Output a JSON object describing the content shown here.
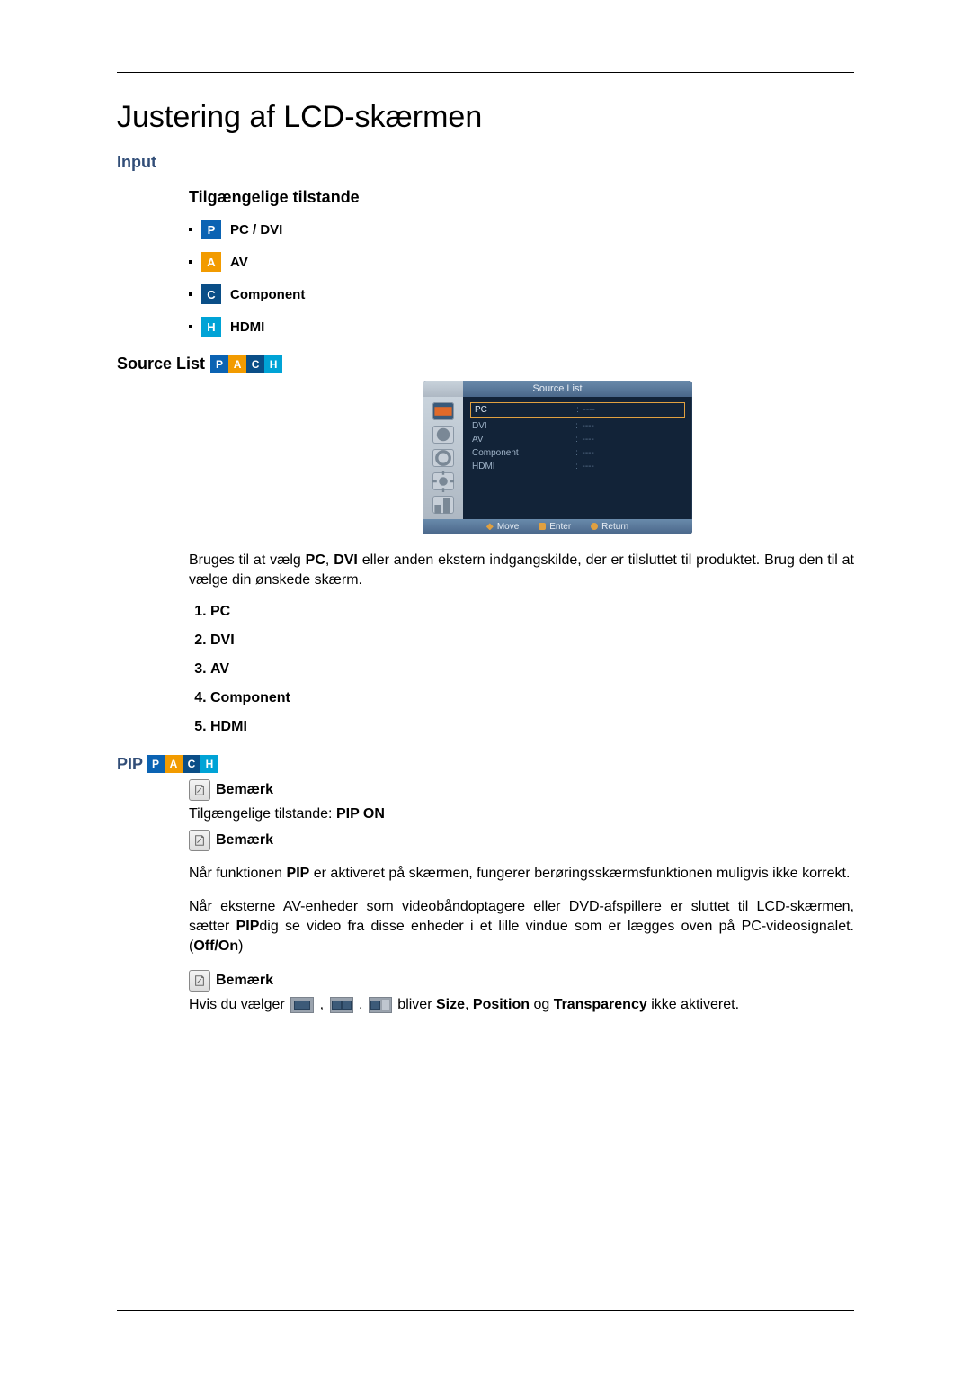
{
  "title": "Justering af LCD-skærmen",
  "sections": {
    "input_heading": "Input",
    "modes_heading": "Tilgængelige tilstande",
    "modes": [
      {
        "badge": "P",
        "label": "PC / DVI"
      },
      {
        "badge": "A",
        "label": "AV"
      },
      {
        "badge": "C",
        "label": "Component"
      },
      {
        "badge": "H",
        "label": "HDMI"
      }
    ],
    "source_list_heading": "Source List",
    "source_badges": [
      "P",
      "A",
      "C",
      "H"
    ],
    "osd": {
      "title": "Source List",
      "rows": [
        {
          "k": "PC",
          "v": "----",
          "selected": true
        },
        {
          "k": "DVI",
          "v": "----"
        },
        {
          "k": "AV",
          "v": "----"
        },
        {
          "k": "Component",
          "v": "----"
        },
        {
          "k": "HDMI",
          "v": "----"
        }
      ],
      "footer": {
        "move": "Move",
        "enter": "Enter",
        "return": "Return"
      }
    },
    "source_para_1a": "Bruges til at vælg ",
    "source_para_1b": "PC",
    "source_para_1c": ", ",
    "source_para_1d": "DVI",
    "source_para_1e": " eller anden ekstern indgangskilde, der er tilsluttet til produktet. Brug den til at vælge din ønskede skærm.",
    "source_items": [
      "PC",
      "DVI",
      "AV",
      "Component",
      "HDMI"
    ],
    "pip_heading": "PIP",
    "pip_badges": [
      "P",
      "A",
      "C",
      "H"
    ],
    "note_label": "Bemærk",
    "pip_modes_a": "Tilgængelige tilstande: ",
    "pip_modes_b": "PIP ON",
    "pip_para2_a": "Når funktionen ",
    "pip_para2_b": "PIP",
    "pip_para2_c": " er aktiveret på skærmen, fungerer berøringsskærmsfunktionen muligvis ikke korrekt.",
    "pip_para3_a": "Når eksterne AV-enheder som videobåndoptagere eller DVD-afspillere er sluttet til LCD-skærmen, sætter ",
    "pip_para3_b": "PIP",
    "pip_para3_c": "dig se video fra disse enheder i et lille vindue som er lægges oven på PC-videosignalet. (",
    "pip_para3_d": "Off/On",
    "pip_para3_e": ")",
    "pip_para4_a": "Hvis du vælger ",
    "pip_para4_b": " , ",
    "pip_para4_c": " , ",
    "pip_para4_d": " bliver ",
    "pip_para4_e": "Size",
    "pip_para4_f": ", ",
    "pip_para4_g": "Position",
    "pip_para4_h": " og ",
    "pip_para4_i": "Transparency",
    "pip_para4_j": " ikke aktiveret."
  }
}
